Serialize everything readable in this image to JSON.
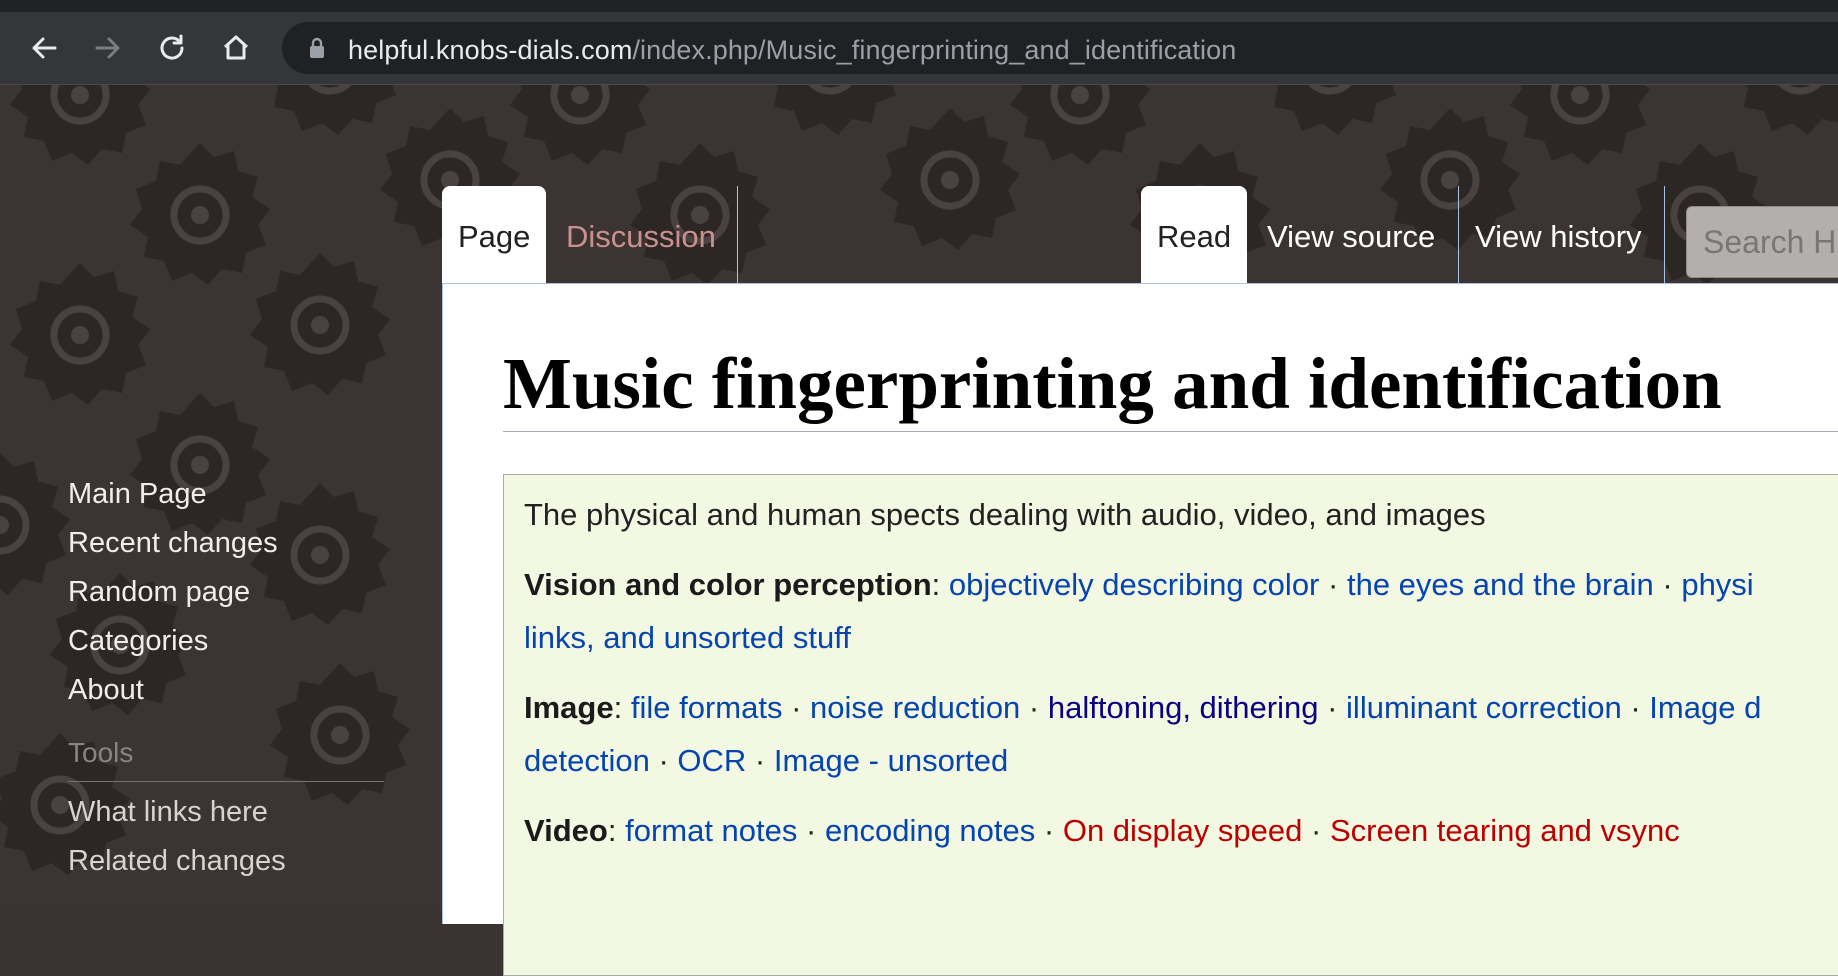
{
  "browser": {
    "url_host": "helpful.knobs-dials.com",
    "url_path": "/index.php/Music_fingerprinting_and_identification",
    "icons": [
      "back-icon",
      "forward-icon",
      "reload-icon",
      "home-icon",
      "lock-icon"
    ]
  },
  "sidebar": {
    "nav": [
      "Main Page",
      "Recent changes",
      "Random page",
      "Categories",
      "About"
    ],
    "tools_heading": "Tools",
    "tools": [
      "What links here",
      "Related changes"
    ]
  },
  "tabs": {
    "page": "Page",
    "discussion": "Discussion",
    "read": "Read",
    "view_source": "View source",
    "view_history": "View history",
    "search_placeholder": "Search H"
  },
  "article": {
    "title": "Music fingerprinting and identification",
    "navbox": {
      "intro": "The physical and human spects dealing with audio, video, and images",
      "vision_label": "Vision and color perception",
      "vision_links": [
        "objectively describing color",
        "the eyes and the brain",
        "physi",
        "links, and unsorted stuff"
      ],
      "image_label": "Image",
      "image_links": [
        "file formats",
        "noise reduction",
        "halftoning, dithering",
        "illuminant correction",
        "Image d",
        "detection",
        "OCR",
        "Image - unsorted"
      ],
      "video_label": "Video",
      "video_links": [
        "format notes",
        "encoding notes",
        "On display speed",
        "Screen tearing and vsync"
      ],
      "separator": "·",
      "colon": ":"
    }
  },
  "colors": {
    "link": "#0645ad",
    "visited_link": "#0b0080",
    "red_link": "#ba0000",
    "navbox_bg": "#f3f8e3",
    "browser_toolbar": "#35363a"
  }
}
